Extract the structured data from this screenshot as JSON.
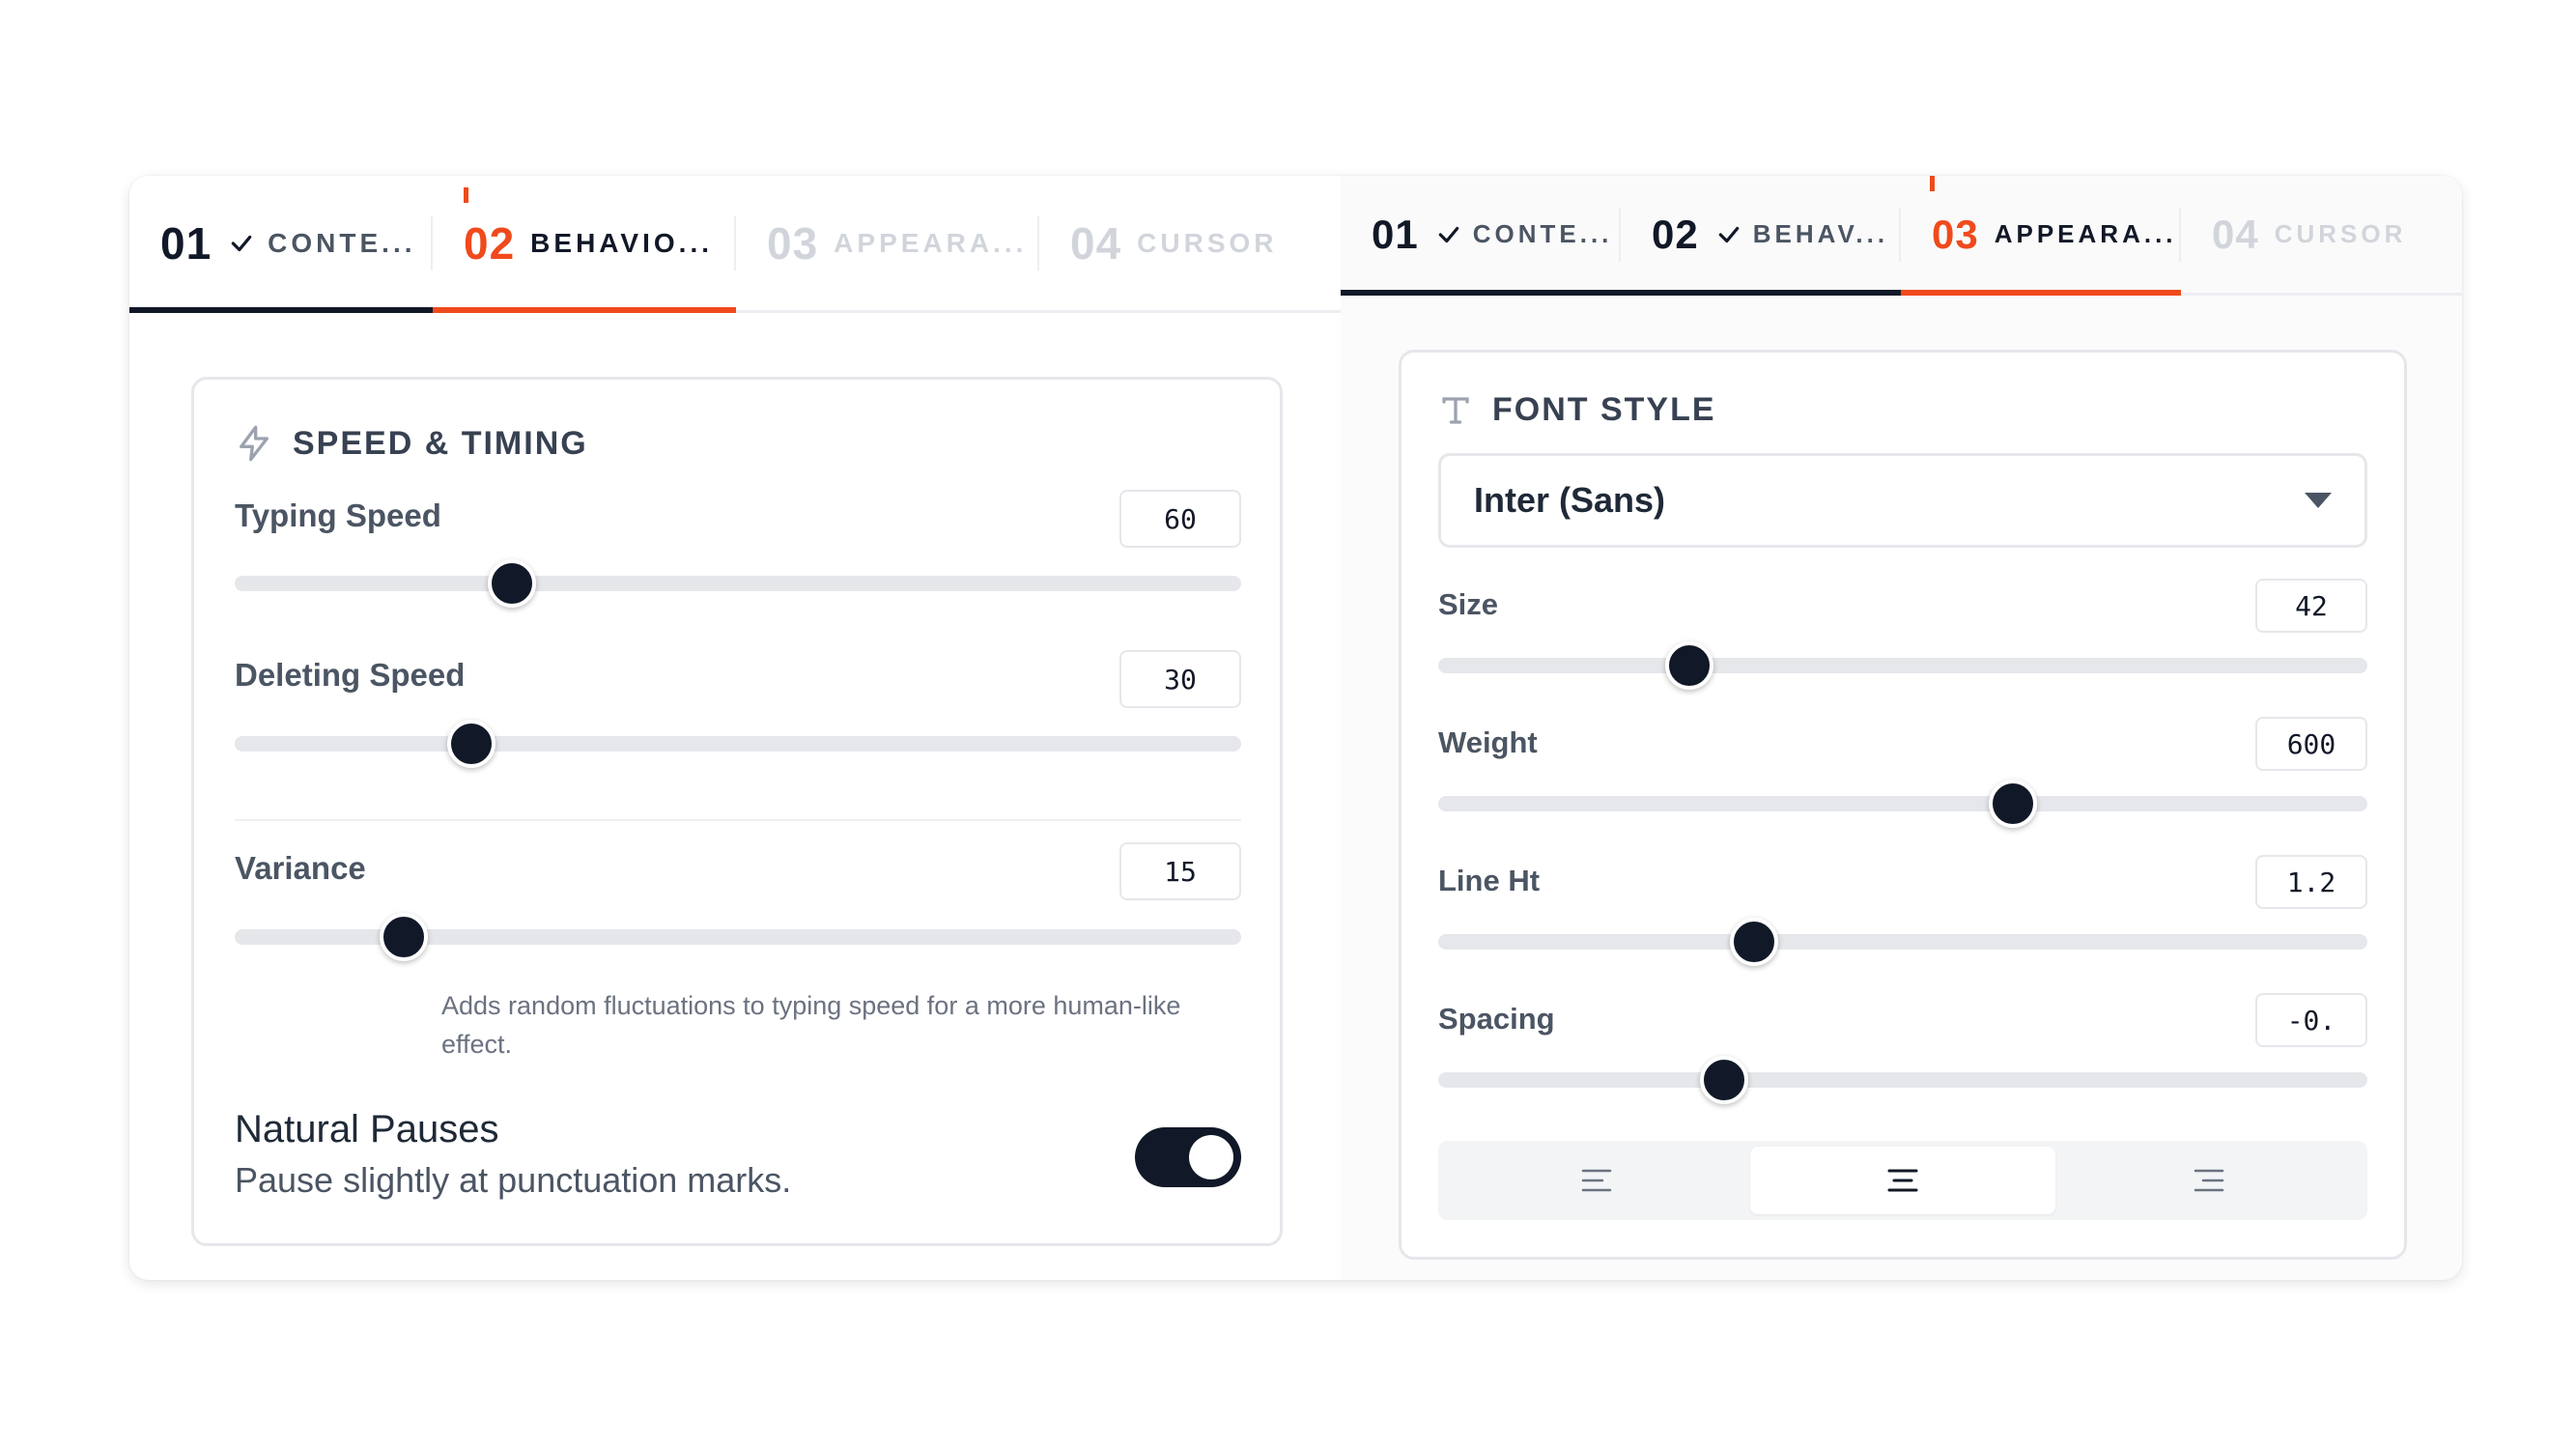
{
  "left_panel": {
    "tabs": [
      {
        "num": "01",
        "label": "CONTE...",
        "state": "done"
      },
      {
        "num": "02",
        "label": "BEHAVIO...",
        "state": "active"
      },
      {
        "num": "03",
        "label": "APPEARA...",
        "state": "future"
      },
      {
        "num": "04",
        "label": "CURSOR",
        "state": "future"
      }
    ],
    "card": {
      "icon": "lightning-icon",
      "title": "SPEED & TIMING",
      "typing_speed": {
        "label": "Typing Speed",
        "value": "60",
        "fraction": 0.275
      },
      "deleting_speed": {
        "label": "Deleting Speed",
        "value": "30",
        "fraction": 0.235
      },
      "variance": {
        "label": "Variance",
        "value": "15",
        "fraction": 0.168
      },
      "variance_help": "Adds random fluctuations to typing speed for a more human-like effect.",
      "natural_pauses": {
        "title": "Natural Pauses",
        "subtitle": "Pause slightly at punctuation marks.",
        "enabled": true
      }
    }
  },
  "right_panel": {
    "tabs": [
      {
        "num": "01",
        "label": "CONTE...",
        "state": "done"
      },
      {
        "num": "02",
        "label": "BEHAV...",
        "state": "done"
      },
      {
        "num": "03",
        "label": "APPEARA...",
        "state": "active"
      },
      {
        "num": "04",
        "label": "CURSOR",
        "state": "future"
      }
    ],
    "card": {
      "icon": "type-icon",
      "title": "FONT STYLE",
      "font_family": "Inter (Sans)",
      "size": {
        "label": "Size",
        "value": "42",
        "fraction": 0.27
      },
      "weight": {
        "label": "Weight",
        "value": "600",
        "fraction": 0.618
      },
      "line_height": {
        "label": "Line Ht",
        "value": "1.2",
        "fraction": 0.34
      },
      "spacing": {
        "label": "Spacing",
        "value": "-0.",
        "fraction": 0.308
      },
      "alignment": {
        "options": [
          "align-left-icon",
          "align-center-icon",
          "align-right-icon"
        ],
        "selected": "align-center-icon"
      }
    }
  },
  "colors": {
    "accent": "#f04a1c",
    "dark": "#111827",
    "muted": "#d1d5db",
    "track": "#e5e7eb"
  }
}
